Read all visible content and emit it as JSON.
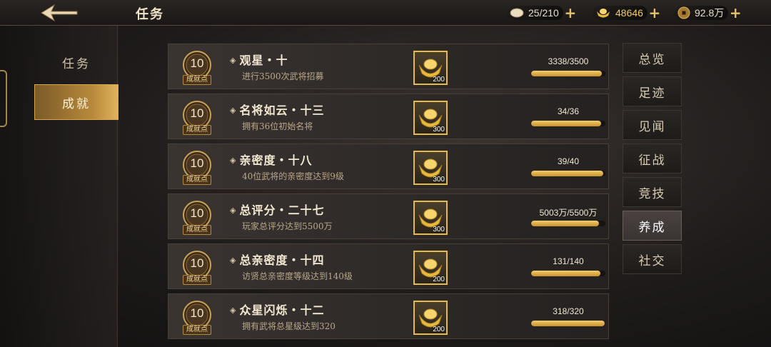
{
  "header": {
    "title": "任务",
    "currencies": [
      {
        "icon": "rice-icon",
        "value": "25/210"
      },
      {
        "icon": "gold-ingot-icon",
        "value": "48646"
      },
      {
        "icon": "coin-icon",
        "value": "92.8万"
      }
    ]
  },
  "sidebar": {
    "tabs": [
      {
        "label": "任务",
        "active": false
      },
      {
        "label": "成就",
        "active": true
      }
    ]
  },
  "achievements": [
    {
      "points": "10",
      "points_label": "成就点",
      "title": "观星・十",
      "desc": "进行3500次武将招募",
      "reward_icon": "gold-ingot-icon",
      "reward_qty": "200",
      "progress_text": "3338/3500",
      "progress": 0.954
    },
    {
      "points": "10",
      "points_label": "成就点",
      "title": "名将如云・十三",
      "desc": "拥有36位初始名将",
      "reward_icon": "gold-ingot-icon",
      "reward_qty": "300",
      "progress_text": "34/36",
      "progress": 0.944
    },
    {
      "points": "10",
      "points_label": "成就点",
      "title": "亲密度・十八",
      "desc": "40位武将的亲密度达到9级",
      "reward_icon": "gold-ingot-icon",
      "reward_qty": "300",
      "progress_text": "39/40",
      "progress": 0.975
    },
    {
      "points": "10",
      "points_label": "成就点",
      "title": "总评分・二十七",
      "desc": "玩家总评分达到5500万",
      "reward_icon": "gold-ingot-icon",
      "reward_qty": "300",
      "progress_text": "5003万/5500万",
      "progress": 0.91
    },
    {
      "points": "10",
      "points_label": "成就点",
      "title": "总亲密度・十四",
      "desc": "访贤总亲密度等级达到140级",
      "reward_icon": "gold-ingot-icon",
      "reward_qty": "200",
      "progress_text": "131/140",
      "progress": 0.936
    },
    {
      "points": "10",
      "points_label": "成就点",
      "title": "众星闪烁・十二",
      "desc": "拥有武将总星级达到320",
      "reward_icon": "gold-ingot-icon",
      "reward_qty": "200",
      "progress_text": "318/320",
      "progress": 0.994
    }
  ],
  "categories": [
    {
      "label": "总览",
      "active": false
    },
    {
      "label": "足迹",
      "active": false
    },
    {
      "label": "见闻",
      "active": false
    },
    {
      "label": "征战",
      "active": false
    },
    {
      "label": "竞技",
      "active": false
    },
    {
      "label": "养成",
      "active": true
    },
    {
      "label": "社交",
      "active": false
    }
  ],
  "colors": {
    "accent": "#e5b94a",
    "active_tab": "#b98a3c"
  }
}
